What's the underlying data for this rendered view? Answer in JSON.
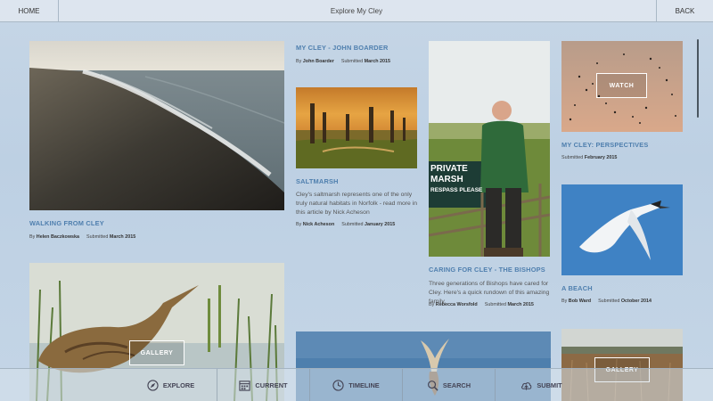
{
  "header": {
    "home_label": "HOME",
    "title": "Explore My Cley",
    "back_label": "BACK"
  },
  "cards": {
    "walking": {
      "title": "WALKING FROM CLEY",
      "by_prefix": "By",
      "author": "Helen Baczkowska",
      "submitted_prefix": "Submitted",
      "date": "March 2015"
    },
    "john": {
      "title": "MY CLEY - JOHN BOARDER",
      "by_prefix": "By",
      "author": "John Boarder",
      "submitted_prefix": "Submitted",
      "date": "March 2015"
    },
    "saltmarsh": {
      "title": "SALTMARSH",
      "description": "Cley's saltmarsh represents one of the only truly natural habitats in Norfolk - read more in this article by Nick Acheson",
      "by_prefix": "By",
      "author": "Nick Acheson",
      "submitted_prefix": "Submitted",
      "date": "January 2015"
    },
    "caring": {
      "title": "CARING FOR CLEY - THE BISHOPS",
      "description": "Three generations of Bishops have cared for Cley. Here's a quick rundown of this amazing family.",
      "by_prefix": "By",
      "author": "Rebecca Worsfold",
      "submitted_prefix": "Submitted",
      "date": "March 2015",
      "sign_line1": "PRIVATE",
      "sign_line2": "MARSH",
      "sign_line3": "RESPASS PLEASE"
    },
    "perspectives": {
      "title": "MY CLEY: PERSPECTIVES",
      "submitted_prefix": "Submitted",
      "date": "February 2015",
      "button_label": "WATCH"
    },
    "beach": {
      "title": "A BEACH",
      "by_prefix": "By",
      "author": "Bob Ward",
      "submitted_prefix": "Submitted",
      "date": "October 2014"
    },
    "bittern": {
      "button_label": "GALLERY"
    },
    "reeds": {
      "button_label": "GALLERY"
    }
  },
  "nav": {
    "explore": "EXPLORE",
    "current": "CURRENT",
    "timeline": "TIMELINE",
    "search": "SEARCH",
    "submit": "SUBMIT"
  }
}
